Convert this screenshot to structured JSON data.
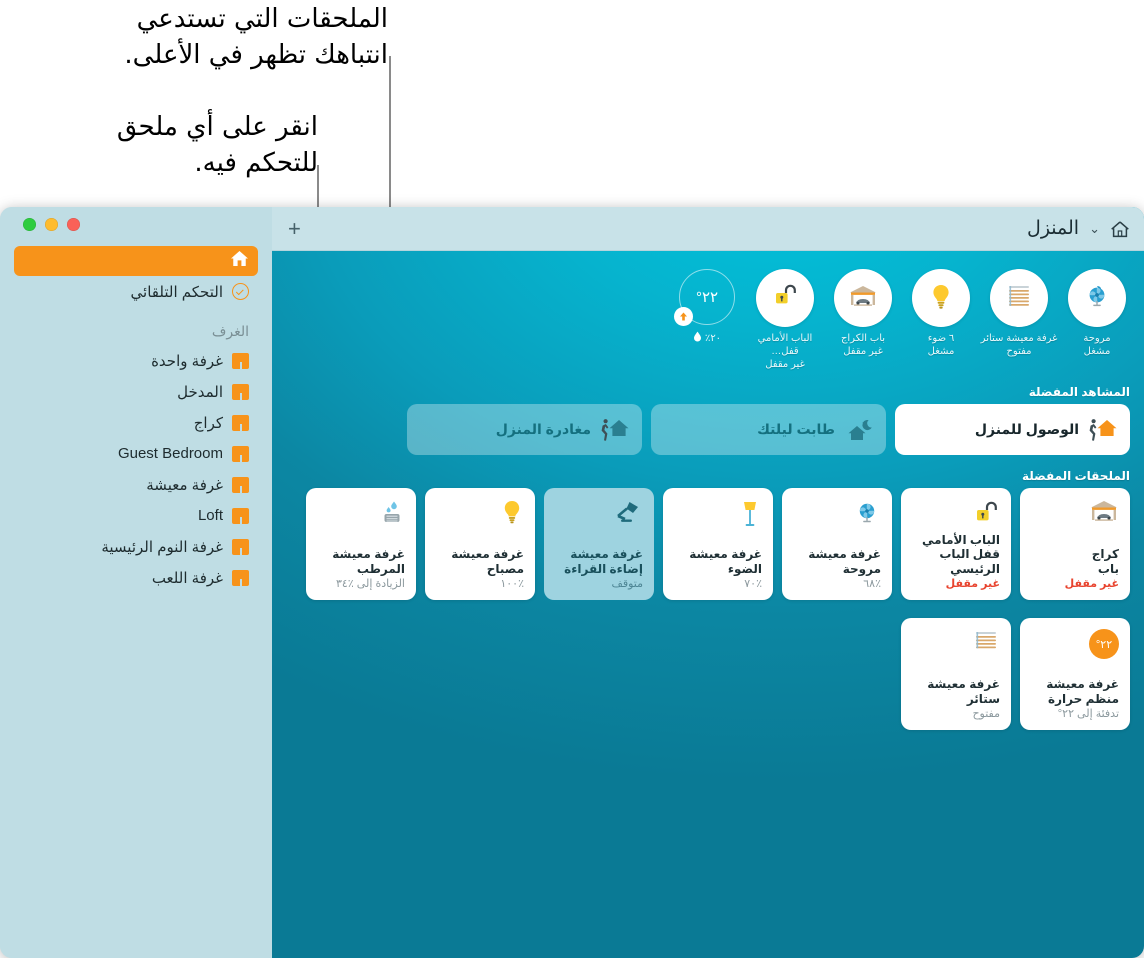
{
  "annotations": {
    "callout_1": "الملحقات التي تستدعي\nانتباهك تظهر في الأعلى.",
    "callout_2": "انقر على أي ملحق\nللتحكم فيه."
  },
  "titlebar": {
    "title": "المنزل",
    "chevron": "⌄",
    "home_icon": "house-icon",
    "add_label": "+"
  },
  "window_controls": {
    "close": "close",
    "minimize": "minimize",
    "zoom": "zoom"
  },
  "sidebar": {
    "home_label": "",
    "automation_label": "التحكم التلقائي",
    "rooms_header": "الغرف",
    "rooms": [
      {
        "label": "غرفة واحدة"
      },
      {
        "label": "المدخل"
      },
      {
        "label": "كراج"
      },
      {
        "label": "Guest Bedroom"
      },
      {
        "label": "غرفة معيشة"
      },
      {
        "label": "Loft"
      },
      {
        "label": "غرفة النوم الرئيسية"
      },
      {
        "label": "غرفة اللعب"
      }
    ]
  },
  "status_row": [
    {
      "icon": "fan-icon",
      "line1": "مروحة",
      "line2": "مشغل"
    },
    {
      "icon": "blinds-icon",
      "line1": "غرفة معيشة ستائر",
      "line2": "مفتوح"
    },
    {
      "icon": "bulb-icon",
      "line1": "٦ ضوء",
      "line2": "مشغل"
    },
    {
      "icon": "garage-door-icon",
      "line1": "باب الكراج",
      "line2": "غير مقفل"
    },
    {
      "icon": "unlocked-lock-icon",
      "line1": "الباب الأمامي قفل…",
      "line2": "غير مقفل"
    }
  ],
  "thermostat": {
    "temperature": "٢٢°",
    "humidity": "٢٠٪",
    "arrow_icon": "heat-up-icon",
    "drop_icon": "humidity-drop-icon"
  },
  "scenes_section": {
    "header": "المشاهد المفضلة",
    "items": [
      {
        "label": "الوصول للمنزل",
        "state": "on",
        "icon": "arrive-home-icon"
      },
      {
        "label": "طابت ليلتك",
        "state": "off",
        "icon": "good-night-icon"
      },
      {
        "label": "مغادرة المنزل",
        "state": "off",
        "icon": "leave-home-icon"
      }
    ]
  },
  "accessories_section": {
    "header": "الملحقات المفضلة",
    "items": [
      {
        "icon": "garage-icon",
        "line1": "كراج",
        "line2": "باب",
        "status": "غير مقفل",
        "status_style": "warn",
        "selected": false
      },
      {
        "icon": "unlocked-lock-icon",
        "line1": "الباب الأمامي",
        "line2": "قفل الباب الرئيسي",
        "status": "غير مقفل",
        "status_style": "warn",
        "selected": false
      },
      {
        "icon": "fan-icon",
        "line1": "غرفة معيشة",
        "line2": "مروحة",
        "status": "٪٦٨",
        "status_style": "normal",
        "selected": false
      },
      {
        "icon": "floor-lamp-icon",
        "line1": "غرفة معيشة",
        "line2": "الضوء",
        "status": "٪٧٠",
        "status_style": "normal",
        "selected": false
      },
      {
        "icon": "desk-lamp-icon",
        "line1": "غرفة معيشة",
        "line2": "إضاءة القراءة",
        "status": "متوقف",
        "status_style": "normal",
        "selected": true
      },
      {
        "icon": "bulb-icon",
        "line1": "غرفة معيشة",
        "line2": "مصباح",
        "status": "٪١٠٠",
        "status_style": "normal",
        "selected": false
      },
      {
        "icon": "humidifier-icon",
        "line1": "غرفة معيشة",
        "line2": "المرطب",
        "status": "الزيادة إلى ٪٣٤",
        "status_style": "normal",
        "selected": false
      },
      {
        "icon": "thermostat-icon",
        "line1": "غرفة معيشة",
        "line2": "منظم حرارة",
        "status": "تدفئة إلى ٢٢°",
        "status_style": "normal",
        "selected": false,
        "badge": "٢٢°"
      },
      {
        "icon": "blinds-icon",
        "line1": "غرفة معيشة",
        "line2": "ستائر",
        "status": "مفتوح",
        "status_style": "normal",
        "selected": false
      }
    ]
  },
  "colors": {
    "accent_orange": "#f7931a",
    "warn_red": "#e8442f",
    "bg_teal": "#0a9cba",
    "sidebar": "#bfdde4"
  }
}
